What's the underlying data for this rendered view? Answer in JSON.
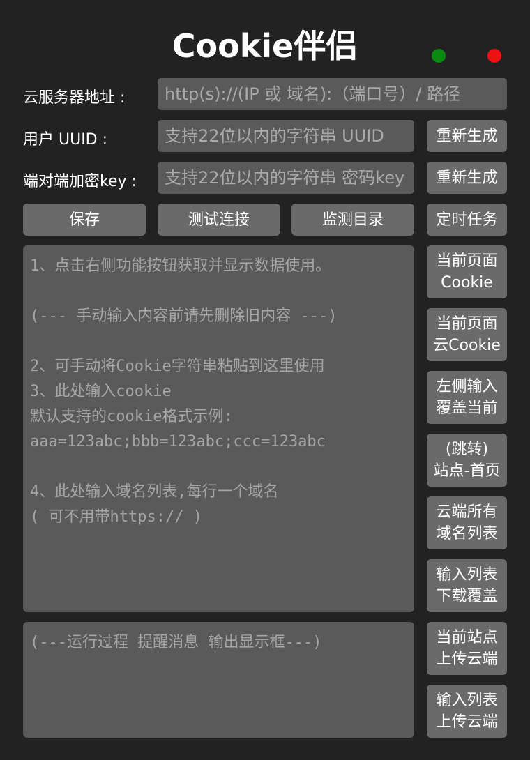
{
  "app": {
    "title": "Cookie伴侣",
    "status_colors": {
      "green": "#0a8a10",
      "red": "#ee1111"
    }
  },
  "form": {
    "server_label": "云服务器地址 :",
    "server_placeholder": "http(s)://(IP 或 域名):（端口号）/ 路径",
    "uuid_label": "用户 UUID :",
    "uuid_placeholder": "支持22位以内的字符串 UUID",
    "key_label": "端对端加密key :",
    "key_placeholder": "支持22位以内的字符串 密码key",
    "regenerate_label": "重新生成"
  },
  "actions": {
    "save": "保存",
    "test": "测试连接",
    "monitor": "监测目录",
    "schedule": "定时任务"
  },
  "side_buttons": [
    "当前页面\nCookie",
    "当前页面\n云Cookie",
    "左侧输入\n覆盖当前",
    "(跳转)\n站点-首页",
    "云端所有\n域名列表",
    "输入列表\n下载覆盖",
    "当前站点\n上传云端",
    "输入列表\n上传云端"
  ],
  "main_input": {
    "placeholder": "1、点击右侧功能按钮获取并显示数据使用。\n\n(--- 手动输入内容前请先删除旧内容 ---)\n\n2、可手动将Cookie字符串粘贴到这里使用\n3、此处输入cookie\n默认支持的cookie格式示例:\naaa=123abc;bbb=123abc;ccc=123abc\n\n4、此处输入域名列表,每行一个域名\n( 可不用带https:// )"
  },
  "output": {
    "placeholder": "(---运行过程 提醒消息 输出显示框---)"
  }
}
